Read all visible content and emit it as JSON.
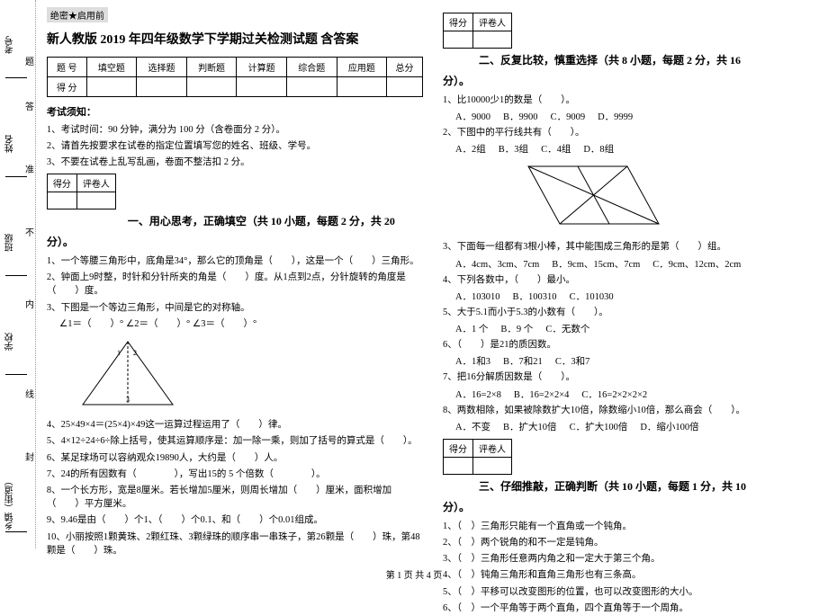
{
  "secret": "绝密★启用前",
  "title": "新人教版 2019 年四年级数学下学期过关检测试题 含答案",
  "header": {
    "c0": "题 号",
    "c1": "填空题",
    "c2": "选择题",
    "c3": "判断题",
    "c4": "计算题",
    "c5": "综合题",
    "c6": "应用题",
    "c7": "总分",
    "r1": "得 分"
  },
  "gutter": {
    "l1": "考号",
    "l2": "姓名",
    "l3": "班级",
    "l4": "学校",
    "l5": "乡镇（街道）",
    "m1": "题",
    "m2": "答",
    "m3": "准",
    "m4": "不",
    "m5": "内",
    "m6": "线",
    "m7": "封"
  },
  "notice": {
    "title": "考试须知：",
    "i1": "1、考试时间：90 分钟，满分为 100 分（含卷面分 2 分）。",
    "i2": "2、请首先按要求在试卷的指定位置填写您的姓名、班级、学号。",
    "i3": "3、不要在试卷上乱写乱画，卷面不整洁扣 2 分。"
  },
  "scorebox": {
    "c1": "得分",
    "c2": "评卷人"
  },
  "s1": {
    "head": "一、用心思考，正确填空（共 10 小题，每题 2 分，共 20",
    "sub": "分）。",
    "q1": "1、一个等腰三角形中，底角是34°，那么它的顶角是（　　），这是一个（　　）三角形。",
    "q2": "2、钟面上9时整，时针和分针所夹的角是（　　）度。从1点到2点，分针旋转的角度是（　　）度。",
    "q3": "3、下图是一个等边三角形，中间是它的对称轴。",
    "q3b": "∠1＝（　　）° ∠2＝（　　）° ∠3＝（　　）°",
    "q4": "4、25×49×4＝(25×4)×49这一运算过程运用了（　　）律。",
    "q5": "5、4×12÷24÷6÷除上括号，使其运算顺序是：加一除一乘，则加了括号的算式是（　　）。",
    "q6": "6、某足球场可以容纳观众19890人，大约是（　　）人。",
    "q7": "7、24的所有因数有（　　　　），写出15的 5 个倍数（　　　　）。",
    "q8": "8、一个长方形，宽是8厘米。若长增加5厘米，则周长增加（　　）厘米，面积增加（　　）平方厘米。",
    "q9": "9、9.46是由（　　）个1、（　　）个0.1、和（　　）个0.01组成。",
    "q10": "10、小丽按照1颗黄珠、2颗红珠、3颗绿珠的顺序串一串珠子，第26颗是（　　）珠，第48颗是（　　）珠。"
  },
  "s2": {
    "head": "二、反复比较，慎重选择（共 8 小题，每题 2 分，共 16",
    "sub": "分）。",
    "q1": "1、比10000少1的数是（　　）。",
    "o1": {
      "a": "A．9000",
      "b": "B．9900",
      "c": "C．9009",
      "d": "D．9999"
    },
    "q2": "2、下图中的平行线共有（　　）。",
    "o2": {
      "a": "A．2组",
      "b": "B．3组",
      "c": "C．4组",
      "d": "D．8组"
    },
    "q3": "3、下面每一组都有3根小棒，其中能围成三角形的是第（　　）组。",
    "o3": {
      "a": "A．4cm、3cm、7cm",
      "b": "B．9cm、15cm、7cm",
      "c": "C．9cm、12cm、2cm"
    },
    "q4": "4、下列各数中，（　　）最小。",
    "o4": {
      "a": "A．103010",
      "b": "B．100310",
      "c": "C．101030"
    },
    "q5": "5、大于5.1而小于5.3的小数有（　　）。",
    "o5": {
      "a": "A．1 个",
      "b": "B．9 个",
      "c": "C．无数个"
    },
    "q6": "6、（　　）是21的质因数。",
    "o6": {
      "a": "A．1和3",
      "b": "B．7和21",
      "c": "C．3和7"
    },
    "q7": "7、把16分解质因数是（　　）。",
    "o7": {
      "a": "A．16=2×8",
      "b": "B．16=2×2×4",
      "c": "C．16=2×2×2×2"
    },
    "q8": "8、两数相除，如果被除数扩大10倍，除数缩小10倍，那么商会（　　）。",
    "o8": {
      "a": "A．不变",
      "b": "B．扩大10倍",
      "c": "C．扩大100倍",
      "d": "D．缩小100倍"
    }
  },
  "s3": {
    "head": "三、仔细推敲，正确判断（共 10 小题，每题 1 分，共 10",
    "sub": "分）。",
    "q1": "1、（　）三角形只能有一个直角或一个钝角。",
    "q2": "2、（　）两个锐角的和不一定是钝角。",
    "q3": "3、（　）三角形任意两内角之和一定大于第三个角。",
    "q4": "4、（　）钝角三角形和直角三角形也有三条高。",
    "q5": "5、（　）平移可以改变图形的位置，也可以改变图形的大小。",
    "q6": "6、（　）一个平角等于两个直角，四个直角等于一个周角。"
  },
  "footer": "第 1 页 共 4 页"
}
